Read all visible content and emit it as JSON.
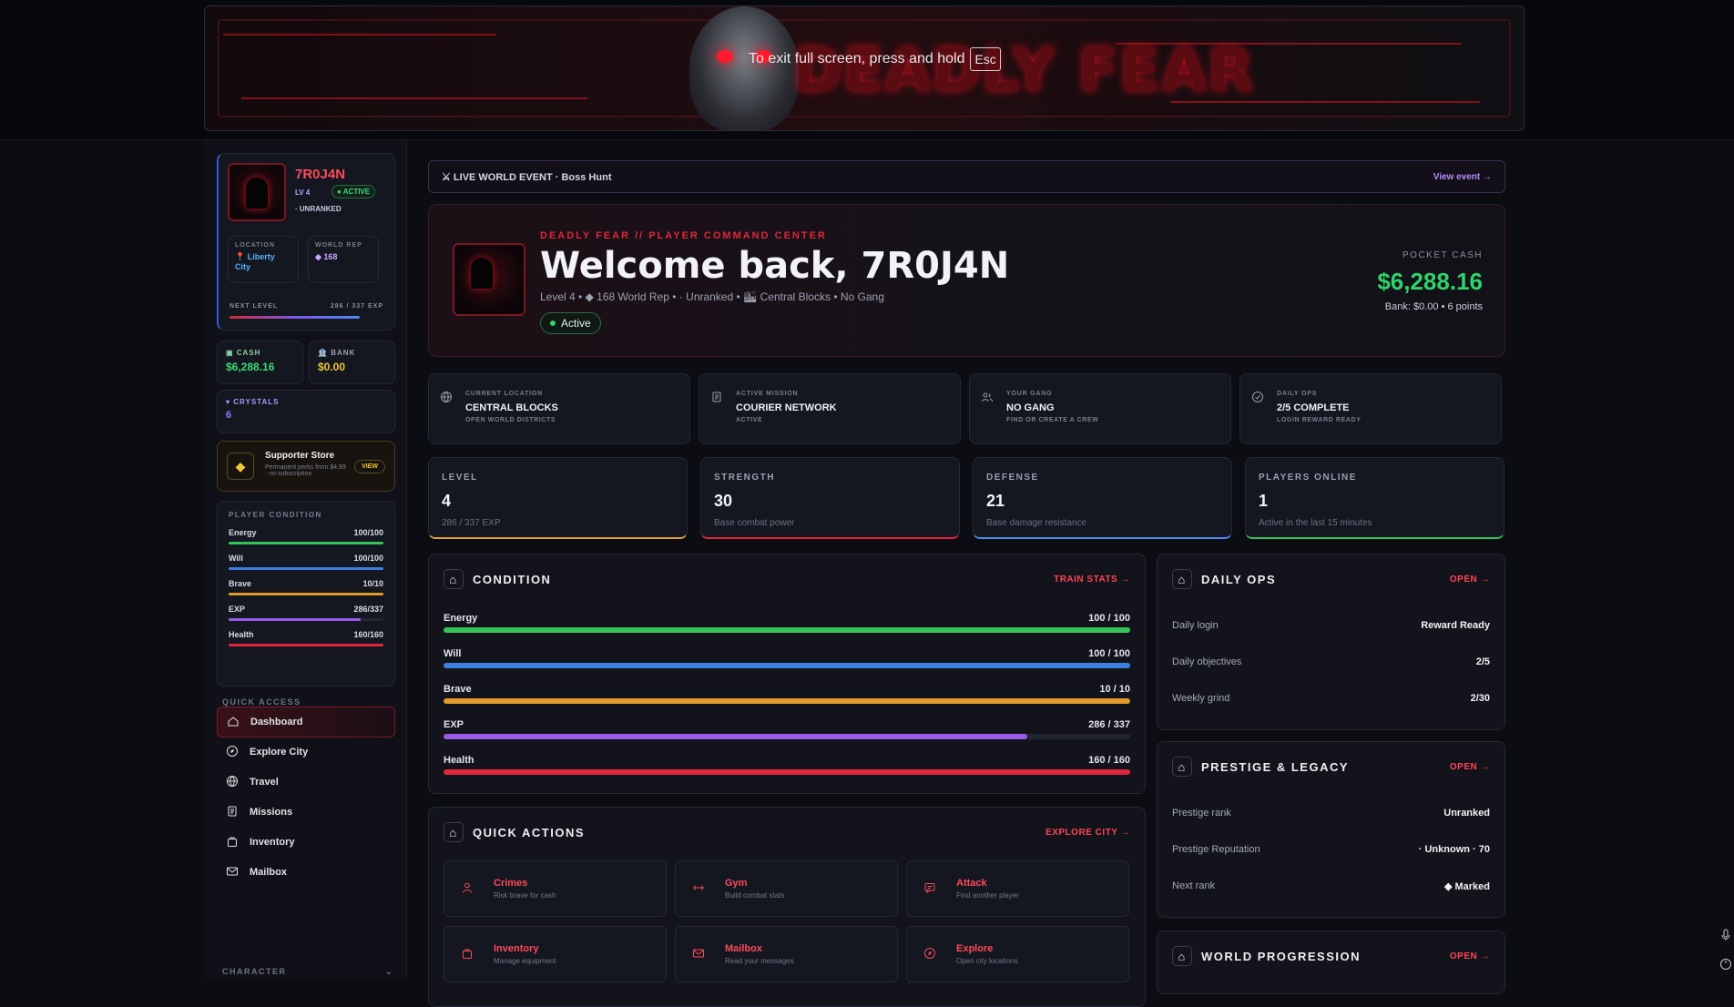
{
  "banner": {
    "logo": "DEADLY FEAR",
    "fullscreen_msg": "To exit full screen, press and hold",
    "fullscreen_key": "Esc"
  },
  "profile": {
    "name": "7R0J4N",
    "level": "LV 4",
    "status": "ACTIVE",
    "rank": "· UNRANKED",
    "location_label": "LOCATION",
    "location_value": "Liberty City",
    "rep_label": "WORLD REP",
    "rep_value": "◆ 168",
    "next_level_label": "NEXT LEVEL",
    "next_level_value": "286 / 337 EXP",
    "next_level_progress": 0.85
  },
  "wallet": {
    "cash_label": "CASH",
    "cash_value": "$6,288.16",
    "bank_label": "BANK",
    "bank_value": "$0.00",
    "crystals_label": "CRYSTALS",
    "crystals_value": "6"
  },
  "store": {
    "title": "Supporter Store",
    "desc": "Permanent perks from $4.99 · no subscription",
    "button": "VIEW"
  },
  "player_condition": {
    "title": "PLAYER CONDITION",
    "rows": [
      {
        "label": "Energy",
        "value": "100/100",
        "pct": 1.0,
        "color": "#35c45a"
      },
      {
        "label": "Will",
        "value": "100/100",
        "pct": 1.0,
        "color": "#3d7fe0"
      },
      {
        "label": "Brave",
        "value": "10/10",
        "pct": 1.0,
        "color": "#e09a2a"
      },
      {
        "label": "EXP",
        "value": "286/337",
        "pct": 0.85,
        "color": "#9a5ae8"
      },
      {
        "label": "Health",
        "value": "160/160",
        "pct": 1.0,
        "color": "#e0253c"
      }
    ]
  },
  "quick_access": {
    "title": "QUICK ACCESS",
    "items": [
      "Dashboard",
      "Explore City",
      "Travel",
      "Missions",
      "Inventory",
      "Mailbox"
    ],
    "section": "CHARACTER"
  },
  "event": {
    "label": "LIVE WORLD EVENT · Boss Hunt",
    "link": "View event →"
  },
  "hero": {
    "kicker": "DEADLY FEAR // PLAYER COMMAND CENTER",
    "title": "Welcome back, 7R0J4N",
    "meta": "Level 4  •  ◆ 168 World Rep  •  · Unranked  •  🏙 Central Blocks  •  No Gang",
    "status": "Active",
    "pocket_label": "POCKET CASH",
    "pocket_value": "$6,288.16",
    "pocket_sub": "Bank: $0.00  •  6 points"
  },
  "info_cards": [
    {
      "k": "CURRENT LOCATION",
      "t": "CENTRAL BLOCKS",
      "s": "OPEN WORLD DISTRICTS",
      "icon": "globe-icon"
    },
    {
      "k": "ACTIVE MISSION",
      "t": "COURIER NETWORK",
      "s": "ACTIVE",
      "icon": "clipboard-icon"
    },
    {
      "k": "YOUR GANG",
      "t": "NO GANG",
      "s": "FIND OR CREATE A CREW",
      "icon": "users-icon"
    },
    {
      "k": "DAILY OPS",
      "t": "2/5 COMPLETE",
      "s": "LOGIN REWARD READY",
      "icon": "check-circle-icon"
    }
  ],
  "stats": [
    {
      "k": "LEVEL",
      "v": "4",
      "s": "286 / 337 EXP",
      "color": "#e0a23a"
    },
    {
      "k": "STRENGTH",
      "v": "30",
      "s": "Base combat power",
      "color": "#e0253c"
    },
    {
      "k": "DEFENSE",
      "v": "21",
      "s": "Base damage resistance",
      "color": "#4a8cf0"
    },
    {
      "k": "PLAYERS ONLINE",
      "v": "1",
      "s": "Active in the last 15 minutes",
      "color": "#35c45a"
    }
  ],
  "condition": {
    "title": "CONDITION",
    "link": "TRAIN STATS →",
    "rows": [
      {
        "label": "Energy",
        "value": "100 / 100",
        "pct": 1.0,
        "color": "#35c45a"
      },
      {
        "label": "Will",
        "value": "100 / 100",
        "pct": 1.0,
        "color": "#3d7fe0"
      },
      {
        "label": "Brave",
        "value": "10 / 10",
        "pct": 1.0,
        "color": "#e09a2a"
      },
      {
        "label": "EXP",
        "value": "286 / 337",
        "pct": 0.85,
        "color": "#9a5ae8"
      },
      {
        "label": "Health",
        "value": "160 / 160",
        "pct": 1.0,
        "color": "#e0253c"
      }
    ]
  },
  "daily_ops": {
    "title": "DAILY OPS",
    "link": "OPEN →",
    "rows": [
      {
        "a": "Daily login",
        "b": "Reward Ready"
      },
      {
        "a": "Daily objectives",
        "b": "2/5"
      },
      {
        "a": "Weekly grind",
        "b": "2/30"
      }
    ]
  },
  "prestige": {
    "title": "PRESTIGE & LEGACY",
    "link": "OPEN →",
    "rows": [
      {
        "a": "Prestige rank",
        "b": "Unranked"
      },
      {
        "a": "Prestige Reputation",
        "b": "· Unknown · 70"
      },
      {
        "a": "Next rank",
        "b": "◆ Marked"
      }
    ]
  },
  "world_progression": {
    "title": "WORLD PROGRESSION",
    "link": "OPEN →"
  },
  "quick_actions": {
    "title": "QUICK ACTIONS",
    "link": "EXPLORE CITY →",
    "items": [
      {
        "n": "Crimes",
        "d": "Risk brave for cash",
        "icon": "person-icon"
      },
      {
        "n": "Gym",
        "d": "Build combat stats",
        "icon": "dumbbell-icon"
      },
      {
        "n": "Attack",
        "d": "Find another player",
        "icon": "chat-icon"
      },
      {
        "n": "Inventory",
        "d": "Manage equipment",
        "icon": "bag-icon"
      },
      {
        "n": "Mailbox",
        "d": "Read your messages",
        "icon": "mail-icon"
      },
      {
        "n": "Explore",
        "d": "Open city locations",
        "icon": "compass-icon"
      }
    ]
  }
}
